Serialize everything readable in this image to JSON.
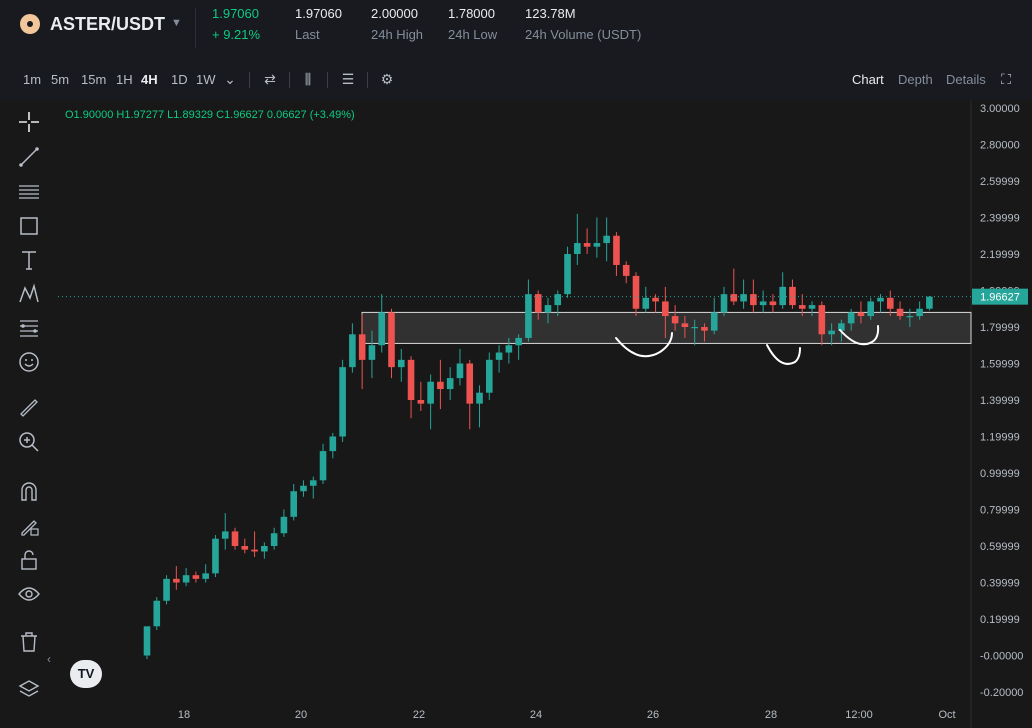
{
  "header": {
    "symbol": "ASTER/USDT",
    "last_price": "1.97060",
    "change_pct": "+ 9.21%",
    "stats": [
      {
        "value": "1.97060",
        "label": "Last"
      },
      {
        "value": "2.00000",
        "label": "24h High"
      },
      {
        "value": "1.78000",
        "label": "24h Low"
      },
      {
        "value": "123.78M",
        "label": "24h Volume (USDT)"
      }
    ]
  },
  "toolbar": {
    "timeframes": [
      "1m",
      "5m",
      "15m",
      "1H",
      "4H",
      "1D",
      "1W"
    ],
    "active_timeframe": "4H",
    "views": [
      "Chart",
      "Depth",
      "Details"
    ],
    "active_view": "Chart"
  },
  "ohlc": {
    "o": "O1.90000",
    "h": "H1.97277",
    "l": "L1.89329",
    "c": "C1.96627",
    "chg": "0.06627 (+3.49%)"
  },
  "colors": {
    "up": "#26a69a",
    "down": "#ef5350",
    "current_price_label": "#26a69a"
  },
  "tv_logo_text": "TV",
  "chart_data": {
    "type": "candlestick",
    "y_ticks": [
      "3.00000",
      "2.80000",
      "2.59999",
      "2.39999",
      "2.19999",
      "1.99999",
      "1.79999",
      "1.59999",
      "1.39999",
      "1.19999",
      "0.99999",
      "0.79999",
      "0.59999",
      "0.39999",
      "0.19999",
      "-0.00000",
      "-0.20000"
    ],
    "x_ticks": [
      "18",
      "20",
      "22",
      "24",
      "26",
      "28",
      "12:00",
      "Oct"
    ],
    "ylim": [
      -0.2,
      3.0
    ],
    "current_price": "1.96627",
    "zone": {
      "top": 1.88,
      "bottom": 1.71
    },
    "candles": [
      {
        "t": "Sep 17 08:00",
        "o": 0.0,
        "h": 0.06,
        "l": -0.02,
        "c": 0.16
      },
      {
        "t": "Sep 17 12:00",
        "o": 0.16,
        "h": 0.32,
        "l": 0.14,
        "c": 0.3
      },
      {
        "t": "Sep 17 16:00",
        "o": 0.3,
        "h": 0.44,
        "l": 0.28,
        "c": 0.42
      },
      {
        "t": "Sep 17 20:00",
        "o": 0.42,
        "h": 0.49,
        "l": 0.36,
        "c": 0.4
      },
      {
        "t": "Sep 18 00:00",
        "o": 0.4,
        "h": 0.48,
        "l": 0.38,
        "c": 0.44
      },
      {
        "t": "Sep 18 04:00",
        "o": 0.44,
        "h": 0.46,
        "l": 0.4,
        "c": 0.42
      },
      {
        "t": "Sep 18 08:00",
        "o": 0.42,
        "h": 0.5,
        "l": 0.4,
        "c": 0.45
      },
      {
        "t": "Sep 18 12:00",
        "o": 0.45,
        "h": 0.66,
        "l": 0.43,
        "c": 0.64
      },
      {
        "t": "Sep 18 16:00",
        "o": 0.64,
        "h": 0.78,
        "l": 0.58,
        "c": 0.68
      },
      {
        "t": "Sep 18 20:00",
        "o": 0.68,
        "h": 0.7,
        "l": 0.58,
        "c": 0.6
      },
      {
        "t": "Sep 19 00:00",
        "o": 0.6,
        "h": 0.64,
        "l": 0.56,
        "c": 0.58
      },
      {
        "t": "Sep 19 04:00",
        "o": 0.58,
        "h": 0.68,
        "l": 0.54,
        "c": 0.57
      },
      {
        "t": "Sep 19 08:00",
        "o": 0.57,
        "h": 0.62,
        "l": 0.53,
        "c": 0.6
      },
      {
        "t": "Sep 19 12:00",
        "o": 0.6,
        "h": 0.7,
        "l": 0.58,
        "c": 0.67
      },
      {
        "t": "Sep 19 16:00",
        "o": 0.67,
        "h": 0.8,
        "l": 0.65,
        "c": 0.76
      },
      {
        "t": "Sep 19 20:00",
        "o": 0.76,
        "h": 0.94,
        "l": 0.74,
        "c": 0.9
      },
      {
        "t": "Sep 20 00:00",
        "o": 0.9,
        "h": 0.96,
        "l": 0.87,
        "c": 0.93
      },
      {
        "t": "Sep 20 04:00",
        "o": 0.93,
        "h": 0.98,
        "l": 0.86,
        "c": 0.96
      },
      {
        "t": "Sep 20 08:00",
        "o": 0.96,
        "h": 1.16,
        "l": 0.94,
        "c": 1.12
      },
      {
        "t": "Sep 20 12:00",
        "o": 1.12,
        "h": 1.22,
        "l": 1.08,
        "c": 1.2
      },
      {
        "t": "Sep 20 16:00",
        "o": 1.2,
        "h": 1.62,
        "l": 1.17,
        "c": 1.58
      },
      {
        "t": "Sep 20 20:00",
        "o": 1.58,
        "h": 1.82,
        "l": 1.55,
        "c": 1.76
      },
      {
        "t": "Sep 21 00:00",
        "o": 1.76,
        "h": 1.87,
        "l": 1.46,
        "c": 1.62
      },
      {
        "t": "Sep 21 04:00",
        "o": 1.62,
        "h": 1.78,
        "l": 1.52,
        "c": 1.7
      },
      {
        "t": "Sep 21 08:00",
        "o": 1.7,
        "h": 1.98,
        "l": 1.66,
        "c": 1.88
      },
      {
        "t": "Sep 21 12:00",
        "o": 1.88,
        "h": 1.9,
        "l": 1.52,
        "c": 1.58
      },
      {
        "t": "Sep 21 16:00",
        "o": 1.58,
        "h": 1.68,
        "l": 1.5,
        "c": 1.62
      },
      {
        "t": "Sep 21 20:00",
        "o": 1.62,
        "h": 1.64,
        "l": 1.3,
        "c": 1.4
      },
      {
        "t": "Sep 22 00:00",
        "o": 1.4,
        "h": 1.5,
        "l": 1.34,
        "c": 1.38
      },
      {
        "t": "Sep 22 04:00",
        "o": 1.38,
        "h": 1.54,
        "l": 1.24,
        "c": 1.5
      },
      {
        "t": "Sep 22 08:00",
        "o": 1.5,
        "h": 1.62,
        "l": 1.35,
        "c": 1.46
      },
      {
        "t": "Sep 22 12:00",
        "o": 1.46,
        "h": 1.58,
        "l": 1.4,
        "c": 1.52
      },
      {
        "t": "Sep 22 16:00",
        "o": 1.52,
        "h": 1.68,
        "l": 1.48,
        "c": 1.6
      },
      {
        "t": "Sep 22 20:00",
        "o": 1.6,
        "h": 1.62,
        "l": 1.24,
        "c": 1.38
      },
      {
        "t": "Sep 23 00:00",
        "o": 1.38,
        "h": 1.48,
        "l": 1.25,
        "c": 1.44
      },
      {
        "t": "Sep 23 04:00",
        "o": 1.44,
        "h": 1.66,
        "l": 1.4,
        "c": 1.62
      },
      {
        "t": "Sep 23 08:00",
        "o": 1.62,
        "h": 1.7,
        "l": 1.55,
        "c": 1.66
      },
      {
        "t": "Sep 23 12:00",
        "o": 1.66,
        "h": 1.74,
        "l": 1.6,
        "c": 1.7
      },
      {
        "t": "Sep 23 16:00",
        "o": 1.7,
        "h": 1.76,
        "l": 1.62,
        "c": 1.74
      },
      {
        "t": "Sep 23 20:00",
        "o": 1.74,
        "h": 2.06,
        "l": 1.72,
        "c": 1.98
      },
      {
        "t": "Sep 24 00:00",
        "o": 1.98,
        "h": 2.0,
        "l": 1.84,
        "c": 1.88
      },
      {
        "t": "Sep 24 04:00",
        "o": 1.88,
        "h": 1.96,
        "l": 1.82,
        "c": 1.92
      },
      {
        "t": "Sep 24 08:00",
        "o": 1.92,
        "h": 2.0,
        "l": 1.86,
        "c": 1.98
      },
      {
        "t": "Sep 24 12:00",
        "o": 1.98,
        "h": 2.24,
        "l": 1.96,
        "c": 2.2
      },
      {
        "t": "Sep 24 16:00",
        "o": 2.2,
        "h": 2.42,
        "l": 2.14,
        "c": 2.26
      },
      {
        "t": "Sep 24 20:00",
        "o": 2.26,
        "h": 2.34,
        "l": 2.2,
        "c": 2.24
      },
      {
        "t": "Sep 25 00:00",
        "o": 2.24,
        "h": 2.4,
        "l": 2.18,
        "c": 2.26
      },
      {
        "t": "Sep 25 04:00",
        "o": 2.26,
        "h": 2.4,
        "l": 2.16,
        "c": 2.3
      },
      {
        "t": "Sep 25 08:00",
        "o": 2.3,
        "h": 2.32,
        "l": 2.08,
        "c": 2.14
      },
      {
        "t": "Sep 25 12:00",
        "o": 2.14,
        "h": 2.16,
        "l": 2.04,
        "c": 2.08
      },
      {
        "t": "Sep 25 16:00",
        "o": 2.08,
        "h": 2.1,
        "l": 1.86,
        "c": 1.9
      },
      {
        "t": "Sep 25 20:00",
        "o": 1.9,
        "h": 2.02,
        "l": 1.88,
        "c": 1.96
      },
      {
        "t": "Sep 26 00:00",
        "o": 1.96,
        "h": 1.98,
        "l": 1.88,
        "c": 1.94
      },
      {
        "t": "Sep 26 04:00",
        "o": 1.94,
        "h": 2.02,
        "l": 1.74,
        "c": 1.86
      },
      {
        "t": "Sep 26 08:00",
        "o": 1.86,
        "h": 1.92,
        "l": 1.78,
        "c": 1.82
      },
      {
        "t": "Sep 26 12:00",
        "o": 1.82,
        "h": 1.86,
        "l": 1.74,
        "c": 1.8
      },
      {
        "t": "Sep 26 16:00",
        "o": 1.8,
        "h": 1.84,
        "l": 1.7,
        "c": 1.8
      },
      {
        "t": "Sep 26 20:00",
        "o": 1.8,
        "h": 1.82,
        "l": 1.72,
        "c": 1.78
      },
      {
        "t": "Sep 27 00:00",
        "o": 1.78,
        "h": 1.96,
        "l": 1.76,
        "c": 1.88
      },
      {
        "t": "Sep 27 04:00",
        "o": 1.88,
        "h": 2.02,
        "l": 1.86,
        "c": 1.98
      },
      {
        "t": "Sep 27 08:00",
        "o": 1.98,
        "h": 2.12,
        "l": 1.92,
        "c": 1.94
      },
      {
        "t": "Sep 27 12:00",
        "o": 1.94,
        "h": 2.06,
        "l": 1.9,
        "c": 1.98
      },
      {
        "t": "Sep 27 16:00",
        "o": 1.98,
        "h": 2.06,
        "l": 1.88,
        "c": 1.92
      },
      {
        "t": "Sep 27 20:00",
        "o": 1.92,
        "h": 2.0,
        "l": 1.88,
        "c": 1.94
      },
      {
        "t": "Sep 28 00:00",
        "o": 1.94,
        "h": 1.98,
        "l": 1.88,
        "c": 1.92
      },
      {
        "t": "Sep 28 04:00",
        "o": 1.92,
        "h": 2.1,
        "l": 1.9,
        "c": 2.02
      },
      {
        "t": "Sep 28 08:00",
        "o": 2.02,
        "h": 2.06,
        "l": 1.9,
        "c": 1.92
      },
      {
        "t": "Sep 28 12:00",
        "o": 1.92,
        "h": 1.98,
        "l": 1.86,
        "c": 1.9
      },
      {
        "t": "Sep 28 16:00",
        "o": 1.9,
        "h": 1.94,
        "l": 1.86,
        "c": 1.92
      },
      {
        "t": "Sep 28 20:00",
        "o": 1.92,
        "h": 1.94,
        "l": 1.7,
        "c": 1.76
      },
      {
        "t": "Sep 29 00:00",
        "o": 1.76,
        "h": 1.82,
        "l": 1.7,
        "c": 1.78
      },
      {
        "t": "Sep 29 04:00",
        "o": 1.78,
        "h": 1.84,
        "l": 1.72,
        "c": 1.82
      },
      {
        "t": "Sep 29 08:00",
        "o": 1.82,
        "h": 1.9,
        "l": 1.78,
        "c": 1.88
      },
      {
        "t": "Sep 29 12:00",
        "o": 1.88,
        "h": 1.94,
        "l": 1.82,
        "c": 1.86
      },
      {
        "t": "Sep 29 16:00",
        "o": 1.86,
        "h": 1.96,
        "l": 1.84,
        "c": 1.94
      },
      {
        "t": "Sep 29 20:00",
        "o": 1.94,
        "h": 1.98,
        "l": 1.88,
        "c": 1.96
      },
      {
        "t": "Sep 30 00:00",
        "o": 1.96,
        "h": 2.0,
        "l": 1.86,
        "c": 1.9
      },
      {
        "t": "Sep 30 04:00",
        "o": 1.9,
        "h": 1.94,
        "l": 1.84,
        "c": 1.86
      },
      {
        "t": "Sep 30 08:00",
        "o": 1.86,
        "h": 1.9,
        "l": 1.8,
        "c": 1.86
      },
      {
        "t": "Sep 30 12:00",
        "o": 1.86,
        "h": 1.94,
        "l": 1.84,
        "c": 1.9
      },
      {
        "t": "Sep 30 16:00",
        "o": 1.9,
        "h": 1.97,
        "l": 1.89,
        "c": 1.966
      }
    ]
  }
}
